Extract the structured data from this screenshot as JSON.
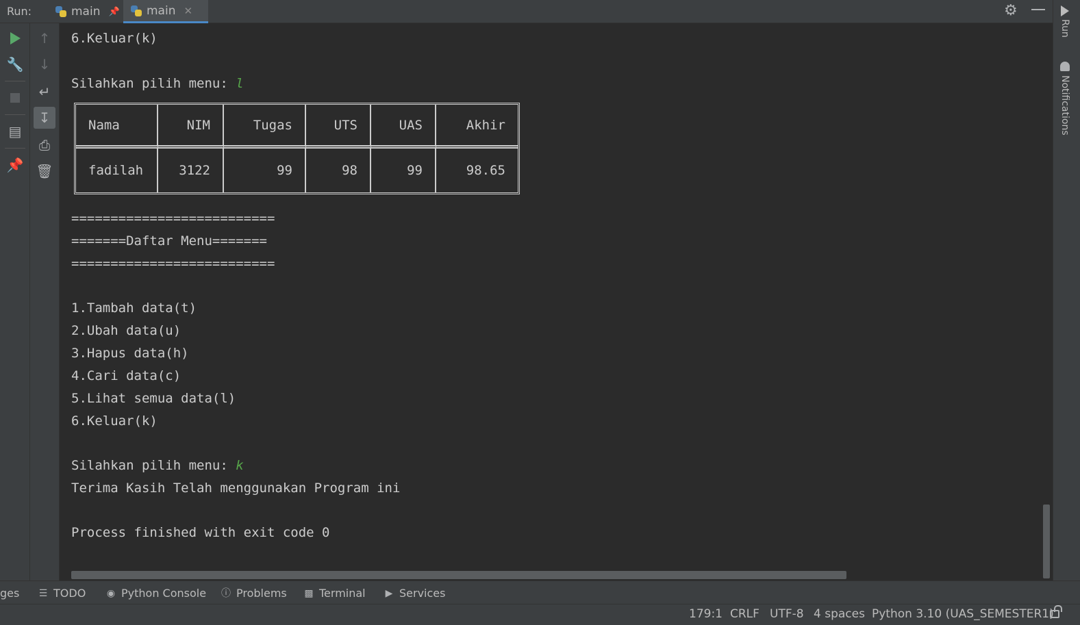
{
  "run_bar": {
    "label": "Run:",
    "tabs": [
      {
        "label": "main",
        "pinned": true,
        "active": false
      },
      {
        "label": "main",
        "pinned": false,
        "active": true
      }
    ]
  },
  "right_strip": {
    "run_label": "Run",
    "notifications_label": "Notifications"
  },
  "console": {
    "lines_top": [
      "6.Keluar(k)",
      "",
      "Silahkan pilih menu: "
    ],
    "first_choice": "l",
    "table": {
      "headers": [
        "Nama",
        "NIM",
        "Tugas",
        "UTS",
        "UAS",
        "Akhir"
      ],
      "rows": [
        [
          "fadilah",
          "3122",
          "99",
          "98",
          "99",
          "98.65"
        ]
      ]
    },
    "separator": "==========================",
    "menu_title": "=======Daftar Menu=======",
    "menu_items": [
      "1.Tambah data(t)",
      "2.Ubah data(u)",
      "3.Hapus data(h)",
      "4.Cari data(c)",
      "5.Lihat semua data(l)",
      "6.Keluar(k)"
    ],
    "prompt": "Silahkan pilih menu: ",
    "second_choice": "k",
    "goodbye": "Terima Kasih Telah menggunakan Program ini",
    "exit_message": "Process finished with exit code 0"
  },
  "tool_windows": {
    "cut_label": "ges",
    "todo": "TODO",
    "python_console": "Python Console",
    "problems": "Problems",
    "terminal": "Terminal",
    "services": "Services"
  },
  "status_bar": {
    "position": "179:1",
    "line_separator": "CRLF",
    "encoding": "UTF-8",
    "indent": "4 spaces",
    "interpreter": "Python 3.10 (UAS_SEMESTER1)"
  },
  "colors": {
    "background": "#2b2b2b",
    "panel": "#3c3f41",
    "user_input": "#57a64a",
    "accent_tab": "#4a88c7"
  }
}
